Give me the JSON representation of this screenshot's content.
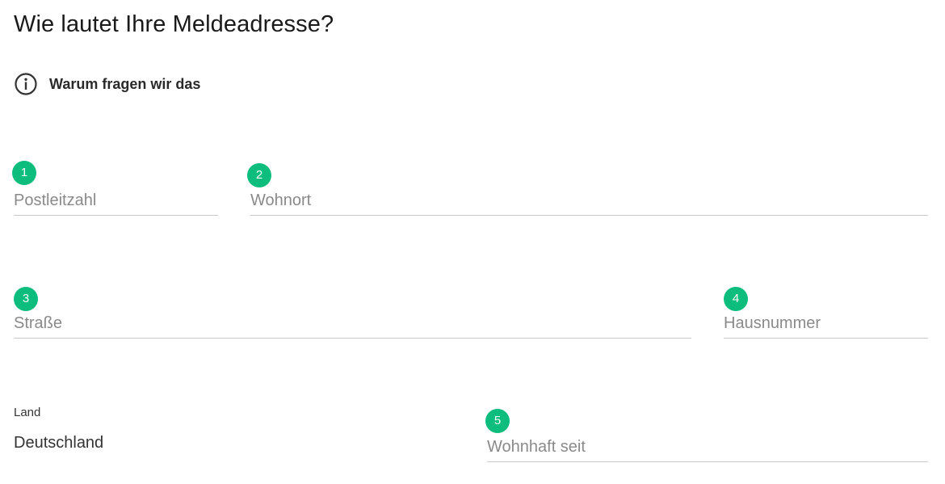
{
  "heading": "Wie lautet Ihre Meldeadresse?",
  "why": {
    "label": "Warum fragen wir das",
    "icon": "info-icon"
  },
  "fields": {
    "postleitzahl": {
      "placeholder": "Postleitzahl",
      "value": "",
      "badge": "1"
    },
    "wohnort": {
      "placeholder": "Wohnort",
      "value": "",
      "badge": "2"
    },
    "strasse": {
      "placeholder": "Straße",
      "value": "",
      "badge": "3"
    },
    "hausnummer": {
      "placeholder": "Hausnummer",
      "value": "",
      "badge": "4"
    },
    "wohnhaft_seit": {
      "placeholder": "Wohnhaft seit",
      "value": "",
      "badge": "5"
    }
  },
  "land": {
    "label": "Land",
    "value": "Deutschland"
  },
  "colors": {
    "badge": "#0dbd7d",
    "placeholder": "#8a8a8a",
    "underline": "#c9c9c9"
  }
}
